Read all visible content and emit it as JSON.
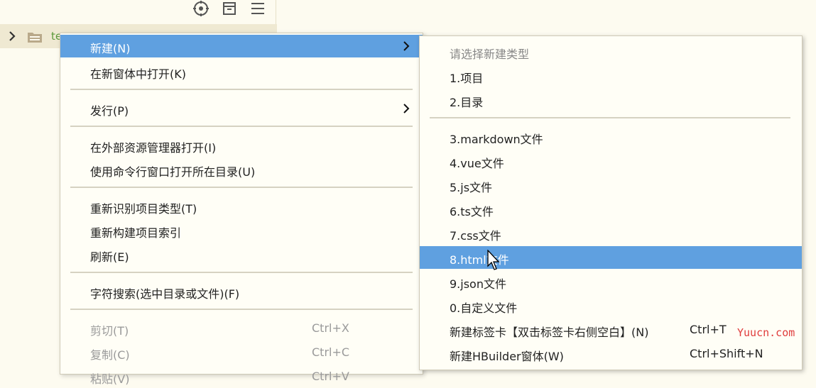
{
  "toolbar": {
    "icons": [
      "locate-icon",
      "collapse-icon",
      "menu-icon"
    ]
  },
  "tree": {
    "label": "te"
  },
  "menu": {
    "items": [
      {
        "label": "新建(N)",
        "arrow": true,
        "active": true
      },
      {
        "label": "在新窗体中打开(K)"
      },
      {
        "label": "发行(P)",
        "arrow": true
      },
      {
        "label": "在外部资源管理器打开(I)"
      },
      {
        "label": "使用命令行窗口打开所在目录(U)"
      },
      {
        "label": "重新识别项目类型(T)"
      },
      {
        "label": "重新构建项目索引"
      },
      {
        "label": "刷新(E)"
      },
      {
        "label": "字符搜索(选中目录或文件)(F)"
      },
      {
        "label": "剪切(T)",
        "shortcut": "Ctrl+X",
        "disabled": true
      },
      {
        "label": "复制(C)",
        "shortcut": "Ctrl+C",
        "disabled": true
      },
      {
        "label": "粘贴(V)",
        "shortcut": "Ctrl+V",
        "disabled": true
      }
    ]
  },
  "submenu": {
    "header": "请选择新建类型",
    "items": [
      {
        "label": "1.项目"
      },
      {
        "label": "2.目录"
      },
      {
        "label": "3.markdown文件"
      },
      {
        "label": "4.vue文件"
      },
      {
        "label": "5.js文件"
      },
      {
        "label": "6.ts文件"
      },
      {
        "label": "7.css文件"
      },
      {
        "label": "8.html文件",
        "active": true
      },
      {
        "label": "9.json文件"
      },
      {
        "label": "0.自定义文件"
      },
      {
        "label": "新建标签卡【双击标签卡右侧空白】(N)",
        "shortcut": "Ctrl+T"
      },
      {
        "label": "新建HBuilder窗体(W)",
        "shortcut": "Ctrl+Shift+N"
      }
    ]
  },
  "watermark": "Yuucn.com",
  "colors": {
    "highlight": "#5fa0e0",
    "background": "#fdfbf0",
    "tree_label": "#5c9a3a",
    "watermark": "#e03c3c"
  }
}
